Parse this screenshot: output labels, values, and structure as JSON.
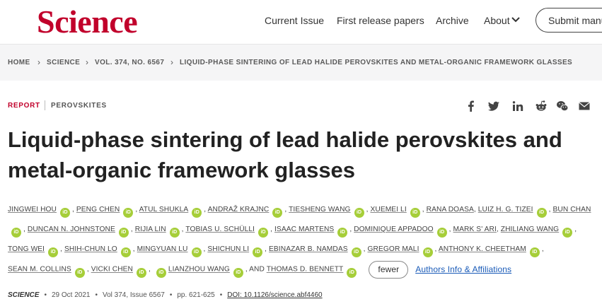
{
  "header": {
    "logo": "Science",
    "nav": [
      "Current Issue",
      "First release papers",
      "Archive",
      "About"
    ],
    "submit_label": "Submit manu"
  },
  "breadcrumb": [
    "HOME",
    "SCIENCE",
    "VOL. 374, NO. 6567",
    "LIQUID-PHASE SINTERING OF LEAD HALIDE PEROVSKITES AND METAL-ORGANIC FRAMEWORK GLASSES"
  ],
  "article": {
    "type": "REPORT",
    "topic": "PEROVSKITES",
    "title": "Liquid-phase sintering of lead halide perovskites and metal-organic framework glasses",
    "share_icons": [
      "facebook-icon",
      "twitter-icon",
      "linkedin-icon",
      "reddit-icon",
      "wechat-icon",
      "email-icon"
    ],
    "orcid_label": "iD",
    "authors": [
      {
        "name": "Jingwei Hou",
        "orcid": true
      },
      {
        "name": "Peng Chen",
        "orcid": true
      },
      {
        "name": "Atul Shukla",
        "orcid": true
      },
      {
        "name": "Andraž Krajnc",
        "orcid": true
      },
      {
        "name": "Tiesheng Wang",
        "orcid": true
      },
      {
        "name": "Xuemei Li",
        "orcid": true
      },
      {
        "name": "Rana Doasa",
        "orcid": false
      },
      {
        "name": "Luiz H. G. Tizei",
        "orcid": true
      },
      {
        "name": "Bun Chan",
        "orcid": true
      },
      {
        "name": "Duncan N. Johnstone",
        "orcid": true
      },
      {
        "name": "Rijia Lin",
        "orcid": true
      },
      {
        "name": "Tobias U. Schülli",
        "orcid": true
      },
      {
        "name": "Isaac Martens",
        "orcid": true
      },
      {
        "name": "Dominique Appadoo",
        "orcid": true
      },
      {
        "name": "Mark S' ari",
        "orcid": false
      },
      {
        "name": "Zhiliang Wang",
        "orcid": true
      },
      {
        "name": "Tong Wei",
        "orcid": true
      },
      {
        "name": "Shih-Chun Lo",
        "orcid": true
      },
      {
        "name": "Mingyuan Lu",
        "orcid": true
      },
      {
        "name": "Shichun Li",
        "orcid": true
      },
      {
        "name": "Ebinazar B. Namdas",
        "orcid": true
      },
      {
        "name": "Gregor Mali",
        "orcid": true
      },
      {
        "name": "Anthony K. Cheetham",
        "orcid": true
      },
      {
        "name": "Sean M. Collins",
        "orcid": true
      },
      {
        "name": "Vicki Chen",
        "orcid": true
      },
      {
        "name": "Lianzhou Wang",
        "orcid": true,
        "leading_orcid": true
      },
      {
        "name": "Thomas D. Bennett",
        "orcid": true
      }
    ],
    "and_text": ", AND",
    "fewer_label": "fewer",
    "affiliations_label": "Authors Info & Affiliations",
    "meta": {
      "journal": "SCIENCE",
      "date": "29 Oct 2021",
      "volume": "Vol 374, Issue 6567",
      "pages": "pp. 621-625",
      "doi": "DOI: 10.1126/science.abf4460"
    }
  }
}
